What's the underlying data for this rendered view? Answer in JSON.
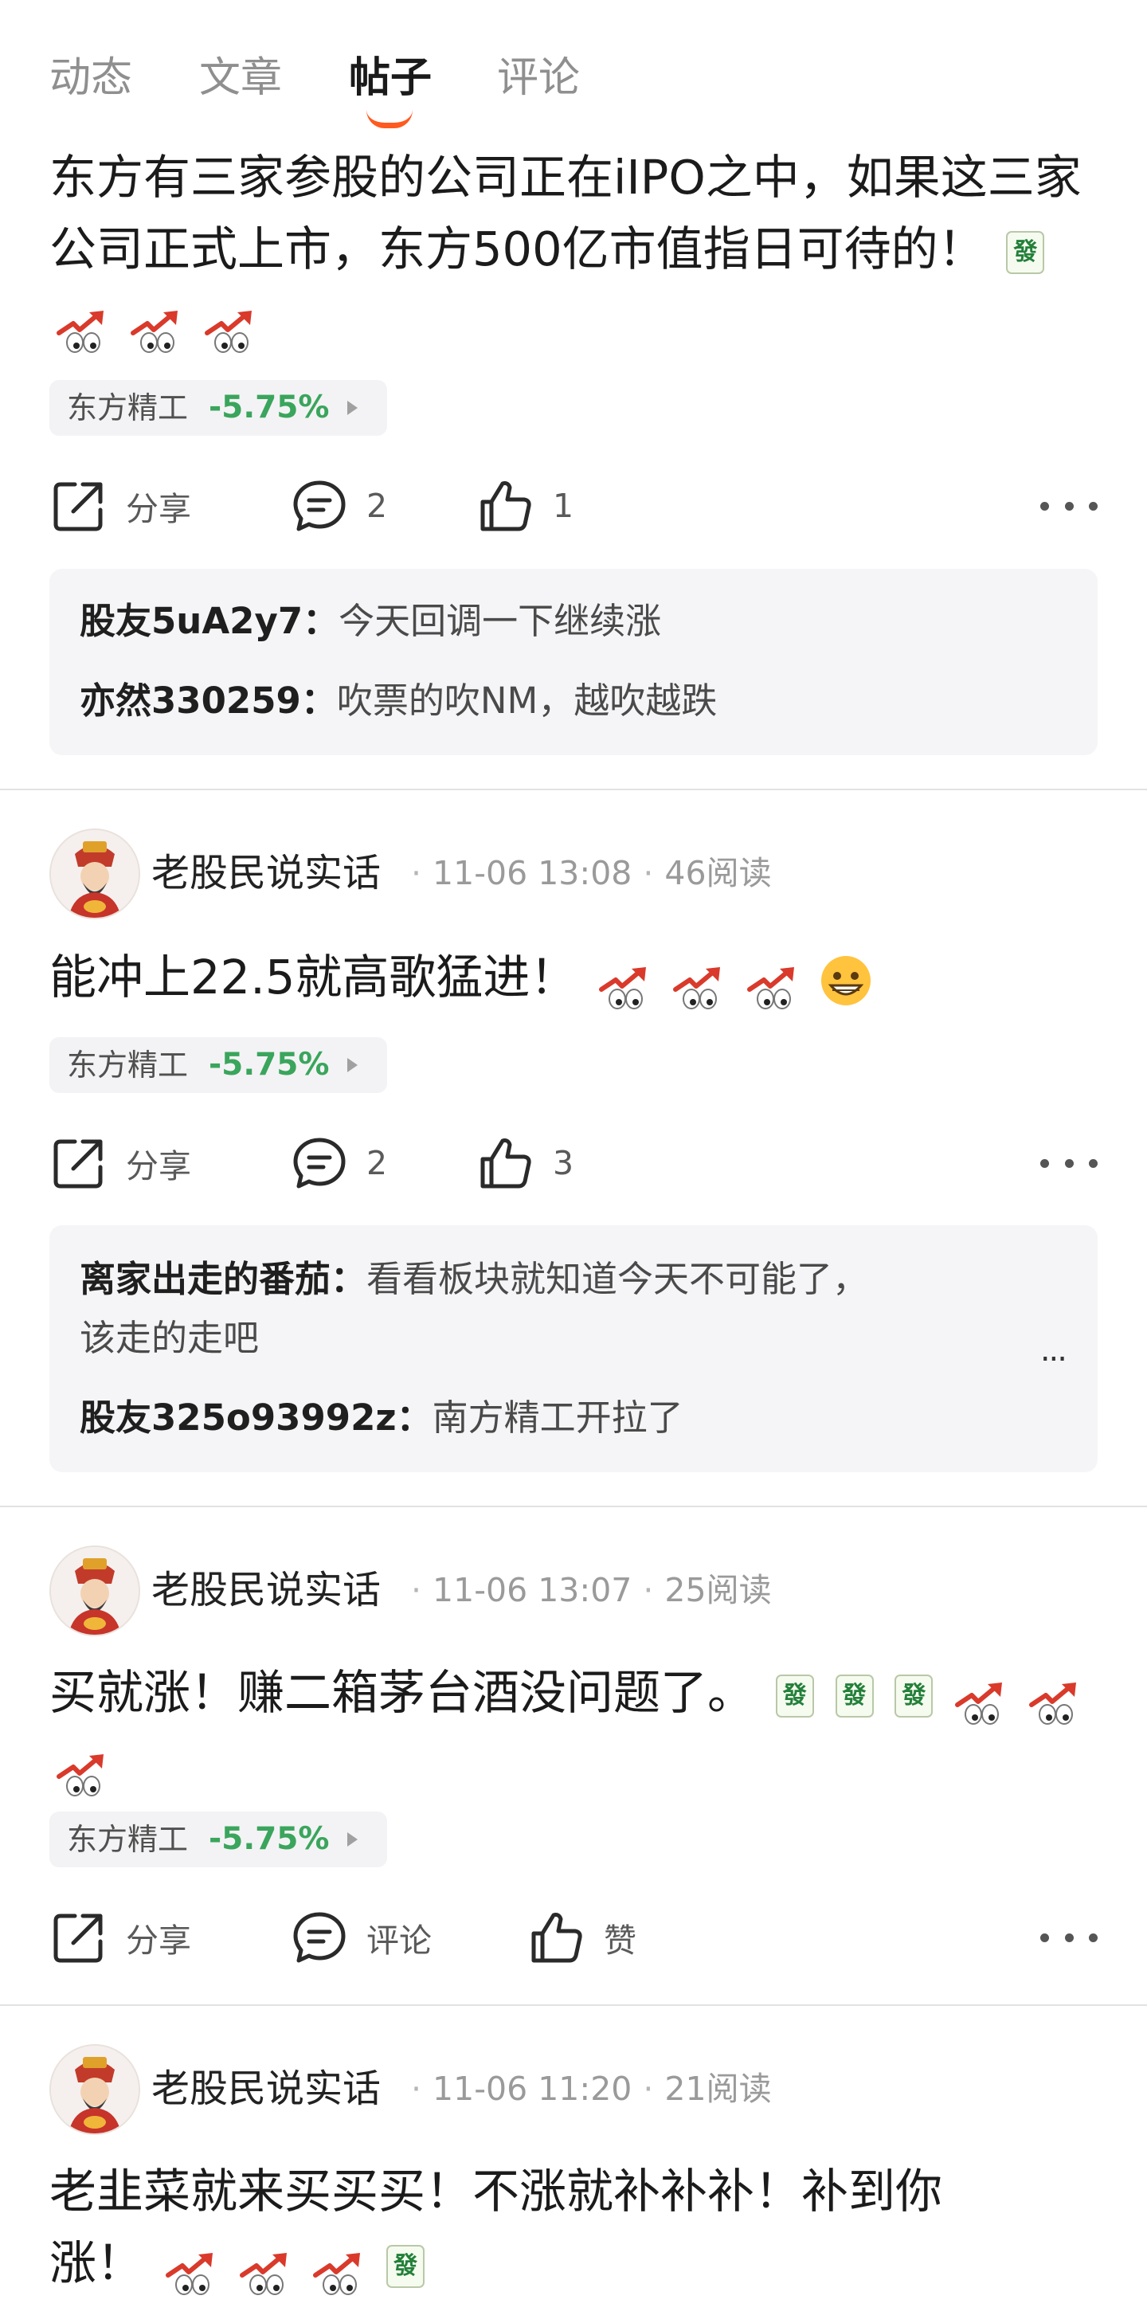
{
  "tabs": [
    {
      "label": "动态"
    },
    {
      "label": "文章"
    },
    {
      "label": "帖子",
      "active": true
    },
    {
      "label": "评论"
    }
  ],
  "posts": [
    {
      "text": "东方有三家参股的公司正在iIPO之中，如果这三家公司正式上市，东方500亿市值指日可待的！",
      "stock": {
        "name": "东方精工",
        "change": "-5.75%"
      },
      "actions": {
        "share": "分享",
        "comment": "2",
        "like": "1"
      },
      "comments": [
        {
          "user": "股友5uA2y7：",
          "text": "今天回调一下继续涨"
        },
        {
          "user": "亦然330259：",
          "text": "吹票的吹NM，越吹越跌"
        }
      ]
    },
    {
      "author": "老股民说实话",
      "time": "11-06 13:08",
      "reads": "46阅读",
      "text": "能冲上22.5就高歌猛进！",
      "stock": {
        "name": "东方精工",
        "change": "-5.75%"
      },
      "actions": {
        "share": "分享",
        "comment": "2",
        "like": "3"
      },
      "comments": [
        {
          "user": "离家出走的番茄：",
          "text": "看看板块就知道今天不可能了，",
          "text2": "该走的走吧"
        },
        {
          "user": "股友325o93992z：",
          "text": "南方精工开拉了"
        }
      ],
      "more_comments": "..."
    },
    {
      "author": "老股民说实话",
      "time": "11-06 13:07",
      "reads": "25阅读",
      "text": "买就涨！赚二箱茅台酒没问题了。",
      "stock": {
        "name": "东方精工",
        "change": "-5.75%"
      },
      "actions": {
        "share": "分享",
        "comment": "评论",
        "like": "赞"
      }
    },
    {
      "author": "老股民说实话",
      "time": "11-06 11:20",
      "reads": "21阅读",
      "text_line1": "老韭菜就来买买买！不涨就补补补！补到你",
      "text_line2": "涨！"
    }
  ],
  "emoji": {
    "fa": "發"
  },
  "colors": {
    "accent": "#ff5a1f",
    "stock_down": "#3aa55c",
    "comment_bg": "#f5f5f7"
  },
  "icons": [
    "share-icon",
    "comment-icon",
    "like-icon",
    "more-icon",
    "rocket-emoji",
    "fa-tile-emoji",
    "grin-emoji",
    "avatar-caishen"
  ]
}
